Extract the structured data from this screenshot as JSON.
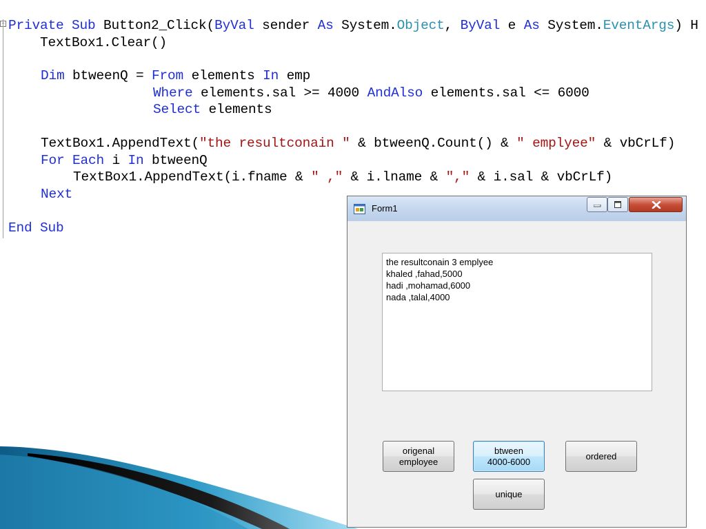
{
  "code": {
    "l1": {
      "a": "Private Sub",
      "b": " Button2_Click(",
      "c": "ByVal",
      "d": " sender ",
      "e": "As",
      "f": " System.",
      "g": "Object",
      "h": ", ",
      "i": "ByVal",
      "j": " e ",
      "k": "As",
      "l": " System.",
      "m": "EventArgs",
      ")": ") H"
    },
    "l2": {
      "a": "    TextBox1.Clear()"
    },
    "l3": {
      "a": "Dim",
      "b": " btweenQ = ",
      "c": "From",
      "d": " elements ",
      "e": "In",
      "f": " emp"
    },
    "l4": {
      "a": "Where",
      "b": " elements.sal >= 4000 ",
      "c": "AndAlso",
      "d": " elements.sal <= 6000"
    },
    "l5": {
      "a": "Select",
      "b": " elements"
    },
    "l6": {
      "a": "TextBox1.AppendText(",
      "b": "\"the resultconain \"",
      "c": " & btweenQ.Count() & ",
      "d": "\" emplyee\"",
      "e": " & vbCrLf)"
    },
    "l7": {
      "a": "For Each",
      "b": " i ",
      "c": "In",
      "d": " btweenQ"
    },
    "l8": {
      "a": "TextBox1.AppendText(i.fname & ",
      "b": "\" ,\"",
      "c": " & i.lname & ",
      "d": "\",\"",
      "e": " & i.sal & vbCrLf)"
    },
    "l9": {
      "a": "Next"
    },
    "l10": {
      "a": "End Sub"
    }
  },
  "window": {
    "title": "Form1",
    "output_lines": [
      "the resultconain 3 emplyee",
      "khaled ,fahad,5000",
      "hadi ,mohamad,6000",
      "nada ,talal,4000"
    ],
    "buttons": {
      "original": "origenal\nemployee",
      "between": "btween\n4000-6000",
      "ordered": "ordered",
      "unique": "unique"
    }
  },
  "colors": {
    "keyword": "#1f2fd6",
    "type": "#2b91af",
    "string": "#a31515"
  }
}
